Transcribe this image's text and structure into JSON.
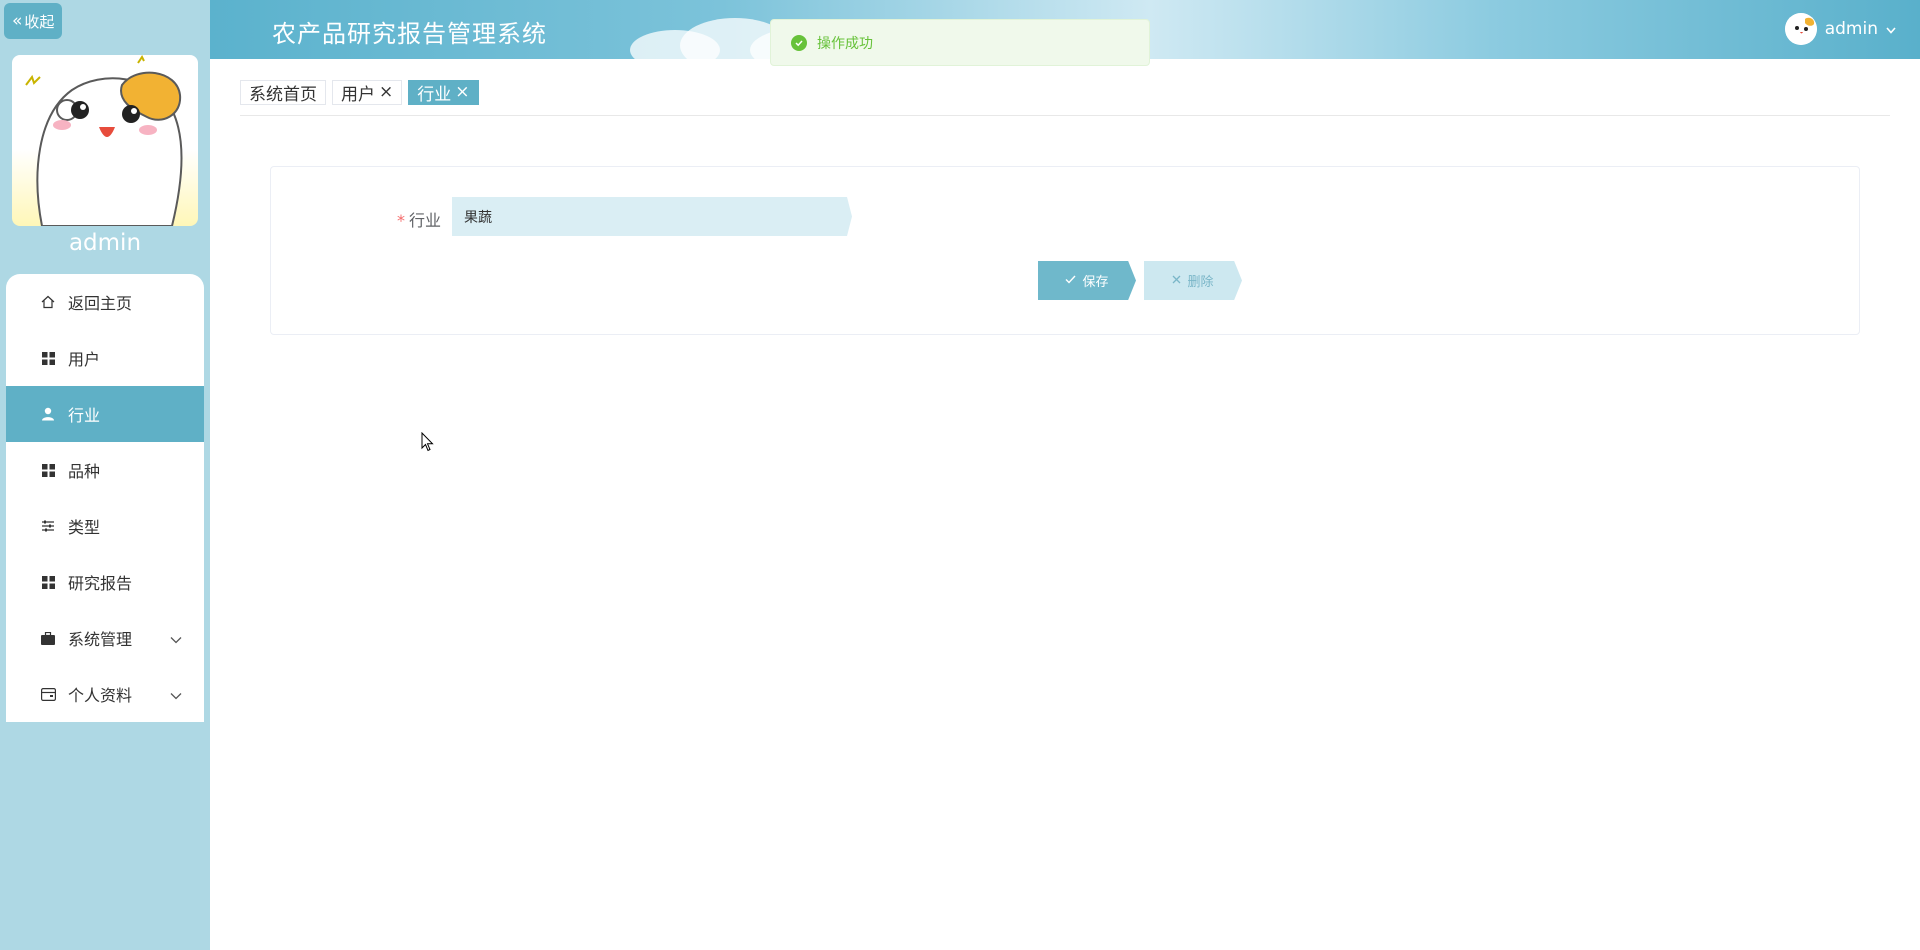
{
  "sidebar": {
    "collapse_label": "收起",
    "username": "admin",
    "menu": [
      {
        "label": "返回主页",
        "icon": "home-icon"
      },
      {
        "label": "用户",
        "icon": "grid-icon"
      },
      {
        "label": "行业",
        "icon": "user-icon",
        "active": true
      },
      {
        "label": "品种",
        "icon": "grid-icon"
      },
      {
        "label": "类型",
        "icon": "sliders-icon"
      },
      {
        "label": "研究报告",
        "icon": "grid-icon"
      },
      {
        "label": "系统管理",
        "icon": "briefcase-icon",
        "expandable": true
      },
      {
        "label": "个人资料",
        "icon": "wallet-icon",
        "expandable": true
      }
    ]
  },
  "header": {
    "title": "农产品研究报告管理系统",
    "user_name": "admin"
  },
  "toast": {
    "message": "操作成功"
  },
  "tabs": [
    {
      "label": "系统首页",
      "closable": false
    },
    {
      "label": "用户",
      "closable": true
    },
    {
      "label": "行业",
      "closable": true,
      "active": true
    }
  ],
  "form": {
    "field_label": "行业",
    "field_value": "果蔬",
    "save_label": "保存",
    "delete_label": "删除"
  },
  "colors": {
    "accent": "#5fb0c6",
    "sidebar_bg": "#aed8e4",
    "success": "#67c23a",
    "required": "#f56c6c"
  }
}
